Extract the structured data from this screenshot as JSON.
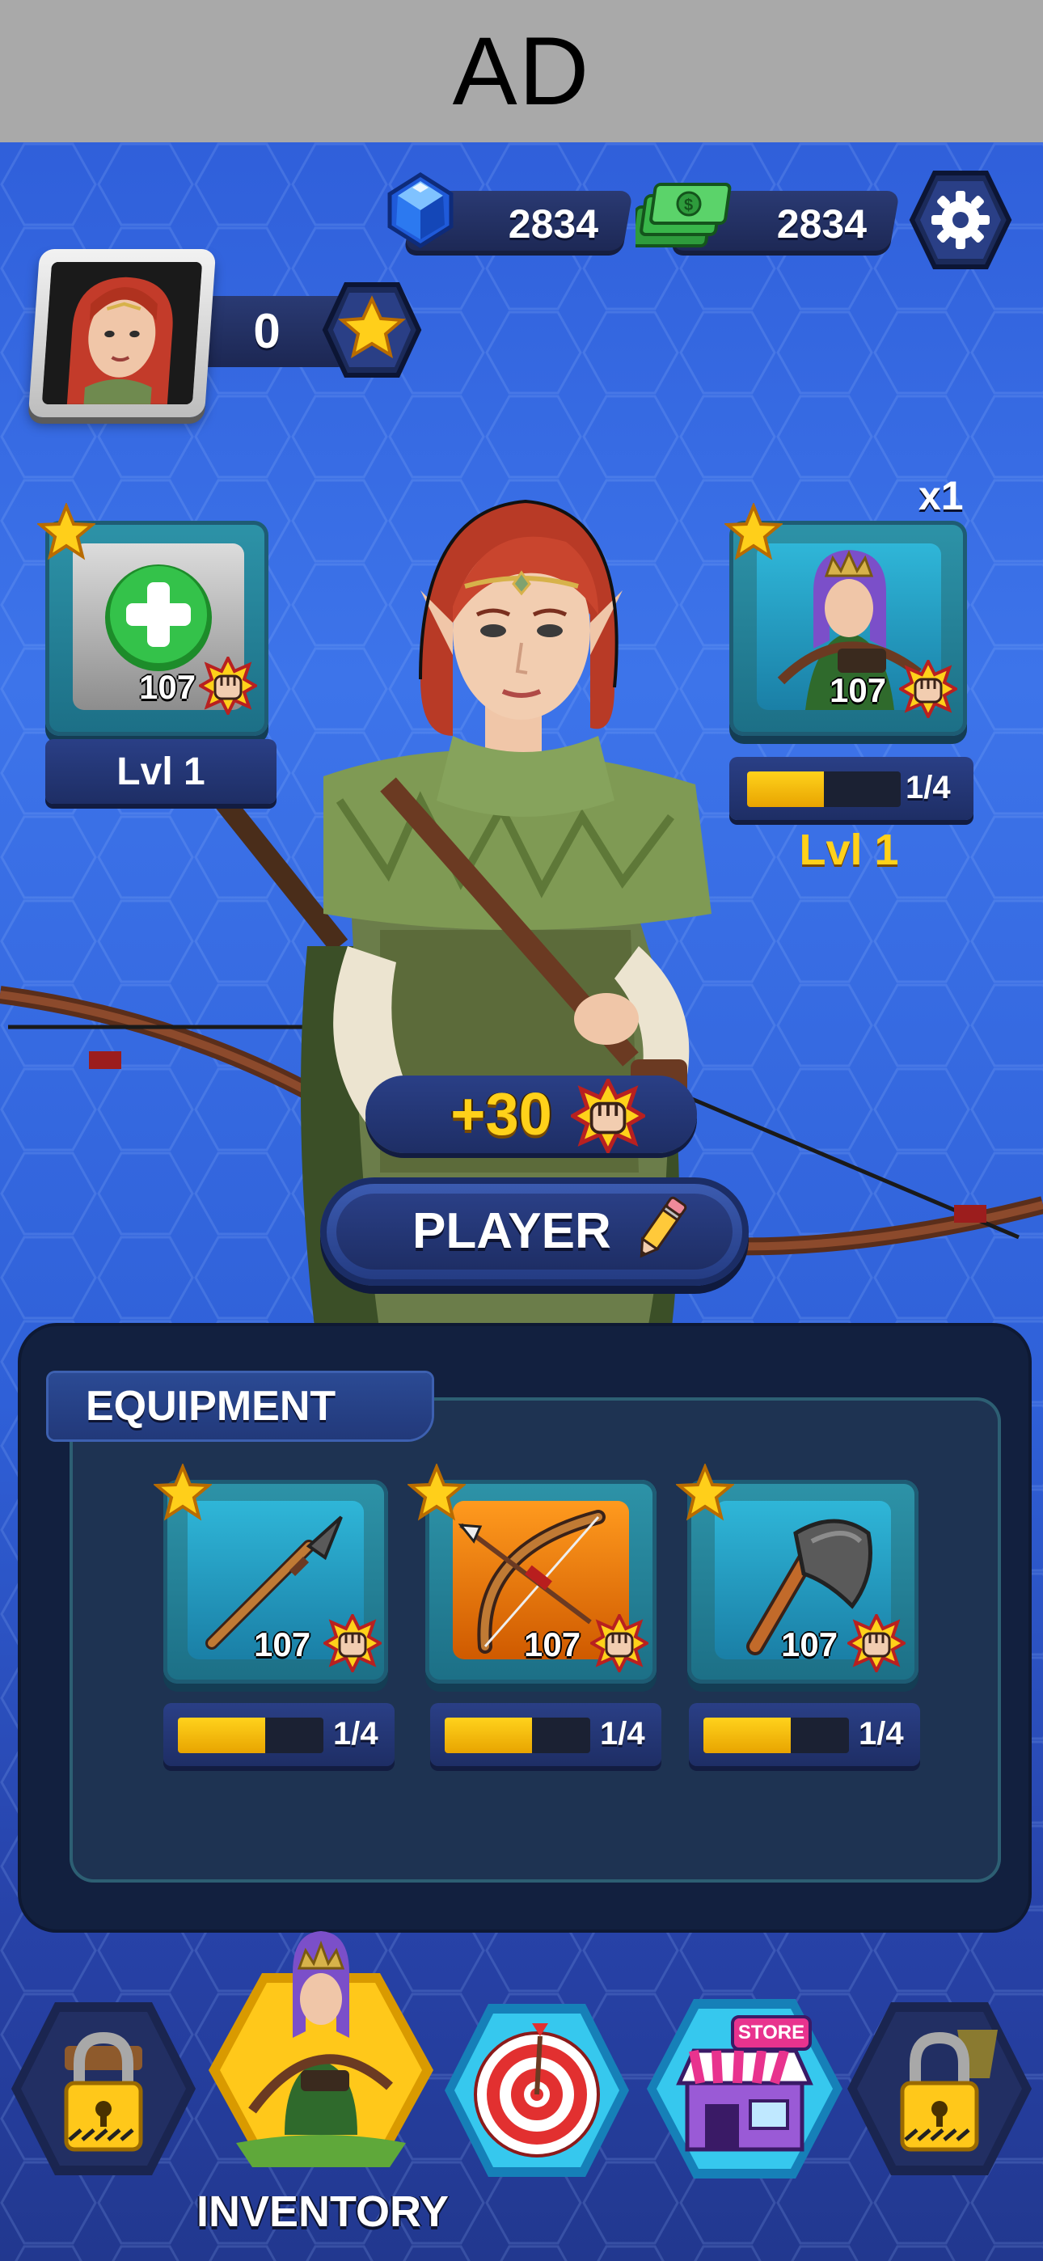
{
  "ad": {
    "label": "AD"
  },
  "currency": {
    "gems": "2834",
    "cash": "2834"
  },
  "profile": {
    "score": "0"
  },
  "character_slots": {
    "left": {
      "power": "107",
      "level": "Lvl 1"
    },
    "right": {
      "power": "107",
      "progress_text": "1/4",
      "progress": 0.5,
      "count": "x1",
      "level": "Lvl 1"
    }
  },
  "bonus": {
    "value": "+30"
  },
  "player_button": {
    "label": "PLAYER"
  },
  "equipment": {
    "title": "EQUIPMENT",
    "items": [
      {
        "name": "spear",
        "power": "107",
        "progress_text": "1/4",
        "progress": 0.6
      },
      {
        "name": "bow",
        "power": "107",
        "progress_text": "1/4",
        "progress": 0.6
      },
      {
        "name": "axe",
        "power": "107",
        "progress_text": "1/4",
        "progress": 0.6
      }
    ]
  },
  "nav": {
    "active_label": "INVENTORY",
    "items": [
      "locked",
      "inventory",
      "target",
      "store",
      "locked"
    ],
    "store_badge": "STORE"
  },
  "colors": {
    "background": "#3d74ea",
    "accent_gold": "#ffd11a",
    "panel": "#12203f",
    "card_teal": "#2d93a8"
  }
}
